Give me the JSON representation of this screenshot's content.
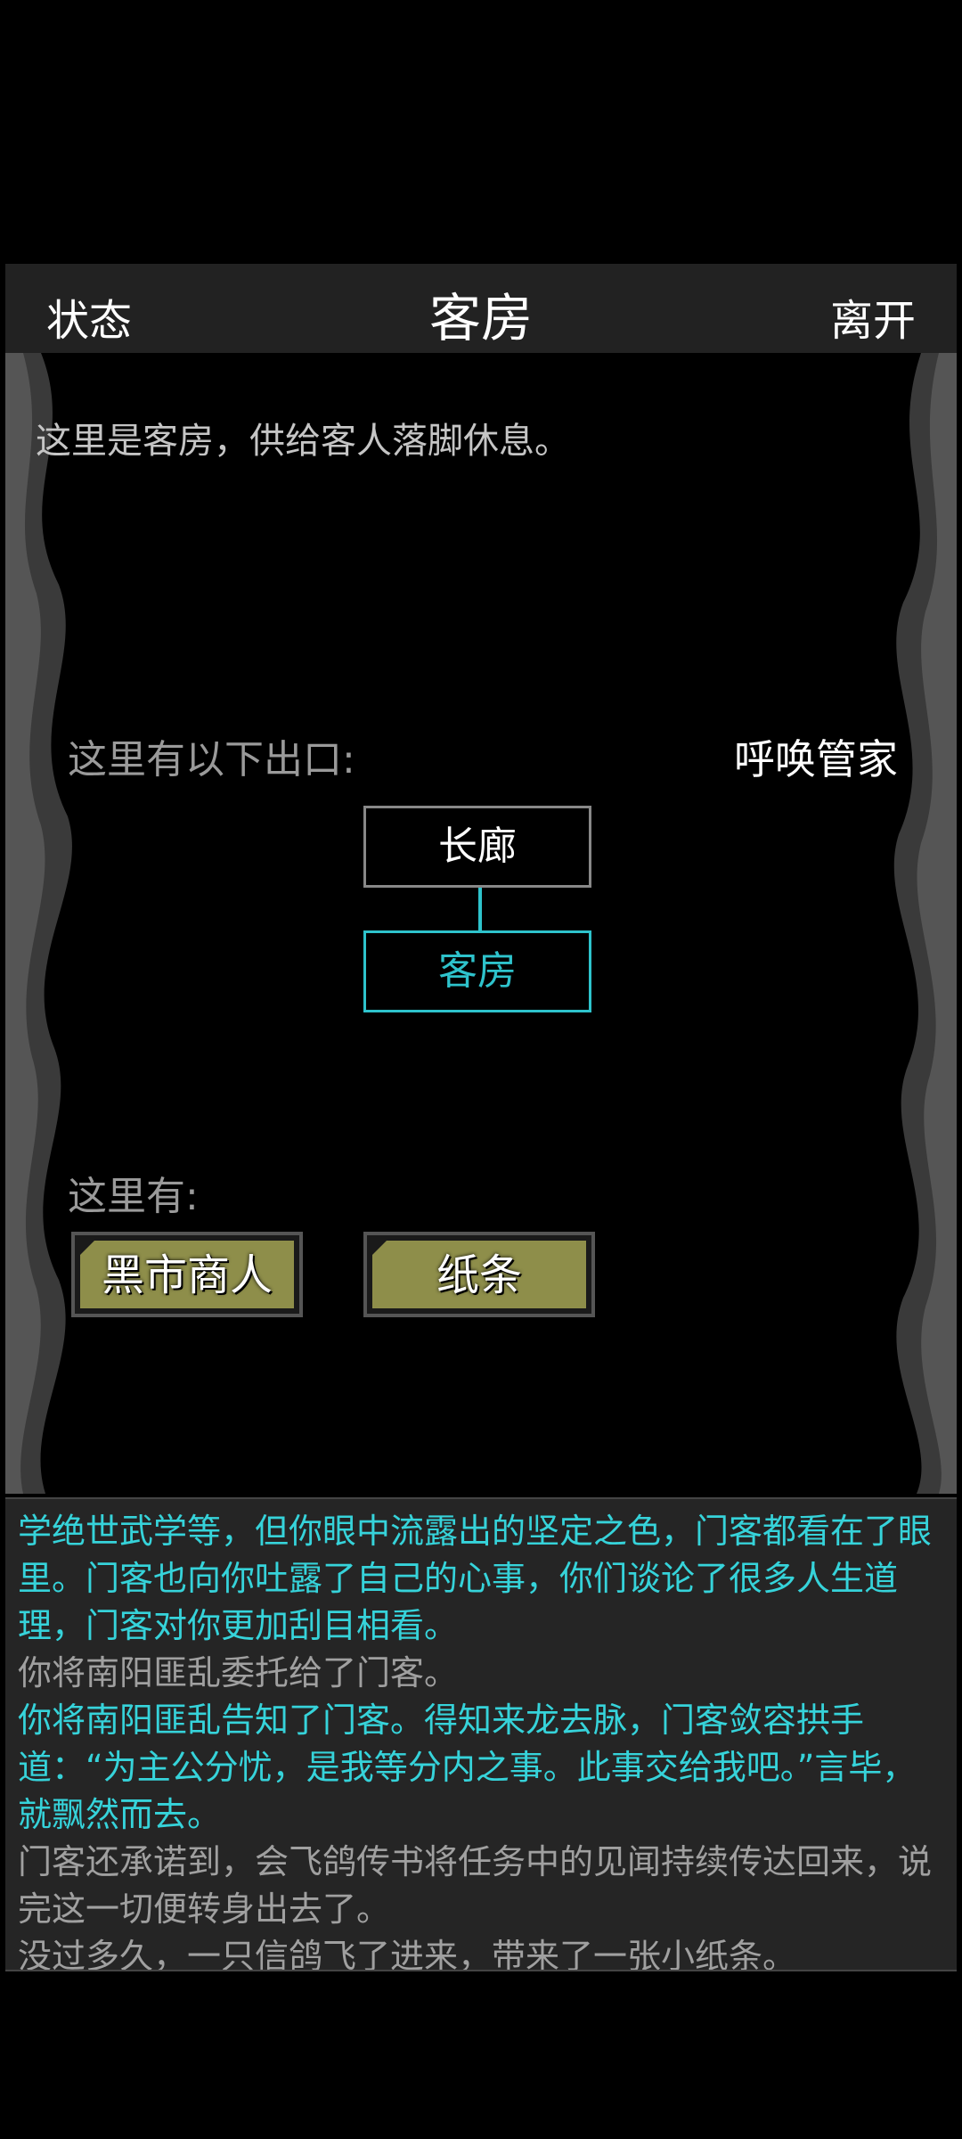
{
  "header": {
    "left_button": "状态",
    "title": "客房",
    "right_button": "离开"
  },
  "room": {
    "description": "这里是客房，供给客人落脚休息。",
    "exits_label": "这里有以下出口:",
    "call_butler": "呼唤管家",
    "map": {
      "north": "长廊",
      "current": "客房"
    },
    "here_label": "这里有:",
    "objects": [
      {
        "label": "黑市商人"
      },
      {
        "label": "纸条"
      }
    ]
  },
  "log": [
    {
      "text": "学绝世武学等，但你眼中流露出的坚定之色，门客都看在了眼里。门客也向你吐露了自己的心事，你们谈论了很多人生道理，门客对你更加刮目相看。",
      "style": "cyan"
    },
    {
      "text": "你将南阳匪乱委托给了门客。",
      "style": "gray"
    },
    {
      "text": "你将南阳匪乱告知了门客。得知来龙去脉，门客敛容拱手道：“为主公分忧，是我等分内之事。此事交给我吧。”言毕，就飘然而去。",
      "style": "cyan"
    },
    {
      "text": "门客还承诺到，会飞鸽传书将任务中的见闻持续传达回来，说完这一切便转身出去了。",
      "style": "gray"
    },
    {
      "text": "没过多久，一只信鸽飞了进来，带来了一张小纸条。",
      "style": "gray"
    }
  ],
  "colors": {
    "accent": "#2ec3cc",
    "object_fill": "#8e8e4a",
    "panel": "#252525"
  }
}
